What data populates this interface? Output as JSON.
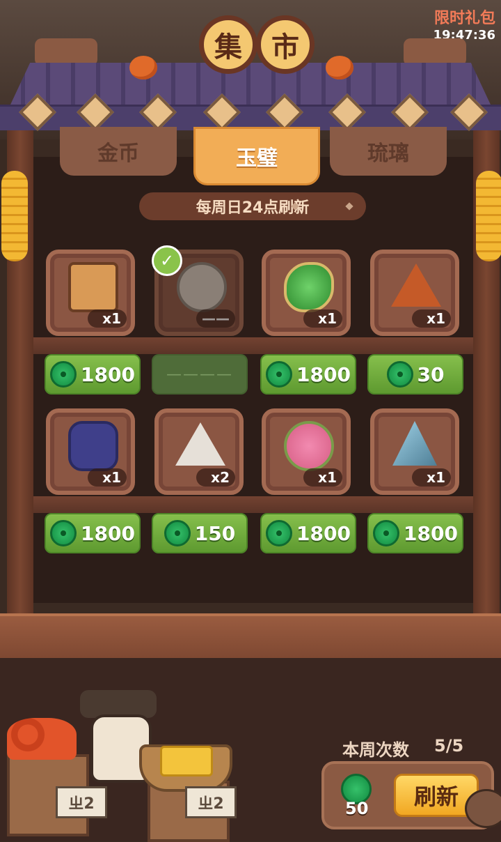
{
  "banner": {
    "label": "限时礼包",
    "countdown": "19:47:36"
  },
  "title": {
    "char1": "集",
    "char2": "市"
  },
  "tabs": [
    {
      "label": "金币",
      "active": false
    },
    {
      "label": "玉璧",
      "active": true
    },
    {
      "label": "琉璃",
      "active": false
    }
  ],
  "refresh_note": "每周日24点刷新",
  "items": [
    {
      "icon": "treasure-chest-icon",
      "qty": "x1",
      "price": "1800",
      "sold": false
    },
    {
      "icon": "character-portrait-icon",
      "qty": "——",
      "price": "————",
      "sold": true
    },
    {
      "icon": "jade-stone-icon",
      "qty": "x1",
      "price": "1800",
      "sold": false
    },
    {
      "icon": "orange-token-icon",
      "qty": "x1",
      "price": "30",
      "sold": false
    },
    {
      "icon": "blue-pot-icon",
      "qty": "x1",
      "price": "1800",
      "sold": false
    },
    {
      "icon": "white-token-icon",
      "qty": "x2",
      "price": "150",
      "sold": false
    },
    {
      "icon": "flower-bouquet-icon",
      "qty": "x1",
      "price": "1800",
      "sold": false
    },
    {
      "icon": "paper-umbrella-icon",
      "qty": "x1",
      "price": "1800",
      "sold": false
    }
  ],
  "weekly": {
    "label": "本周次数",
    "count": "5/5"
  },
  "refresh": {
    "cost": "50",
    "button": "刷新"
  },
  "stall_tags": {
    "left": "ㄓ2",
    "right": "ㄓ2"
  },
  "colors": {
    "price_green": "#6fae3c",
    "tab_active": "#f2ad56",
    "wood": "#8b5643"
  }
}
